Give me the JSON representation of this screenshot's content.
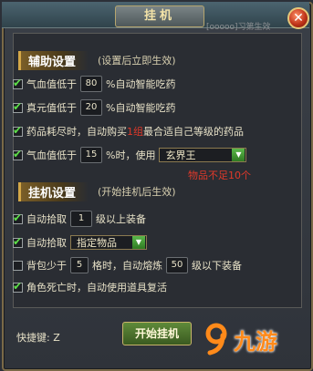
{
  "window": {
    "title": "挂机",
    "title_faded_text": "[ooooo]习第生效",
    "close_glyph": "✕"
  },
  "assist_section": {
    "heading": "辅助设置",
    "sub": "(设置后立即生效)",
    "rows": [
      {
        "checked": true,
        "prefix": "气血值低于",
        "value": "80",
        "suffix": "%自动智能吃药"
      },
      {
        "checked": true,
        "prefix": "真元值低于",
        "value": "20",
        "suffix": "%自动智能吃药"
      },
      {
        "checked": true,
        "prefix": "药品耗尽时，自动购买",
        "highlight": "1组",
        "suffix": "最合适自己等级的药品"
      },
      {
        "checked": true,
        "prefix": "气血值低于",
        "value": "15",
        "middle": "%时，使用",
        "select": "玄界王"
      }
    ],
    "warning": "物品不足10个"
  },
  "idle_section": {
    "heading": "挂机设置",
    "sub": "(开始挂机后生效)",
    "rows": [
      {
        "checked": true,
        "prefix": "自动拾取",
        "value": "1",
        "suffix": "级以上装备"
      },
      {
        "checked": true,
        "prefix": "自动拾取",
        "select": "指定物品"
      },
      {
        "checked": false,
        "prefix": "背包少于",
        "value": "5",
        "middle": "格时，自动熔炼",
        "value2": "50",
        "suffix": "级以下装备"
      },
      {
        "checked": true,
        "prefix": "角色死亡时，自动使用道具复活"
      }
    ]
  },
  "footer": {
    "hotkey_label": "快捷键: Z",
    "start_button": "开始挂机"
  },
  "watermark": {
    "text": "九游"
  },
  "colors": {
    "accent_gold": "#d4a848",
    "check_green": "#5ee04a",
    "warning_red": "#e0392a",
    "logo_orange": "#ff8a1a"
  }
}
